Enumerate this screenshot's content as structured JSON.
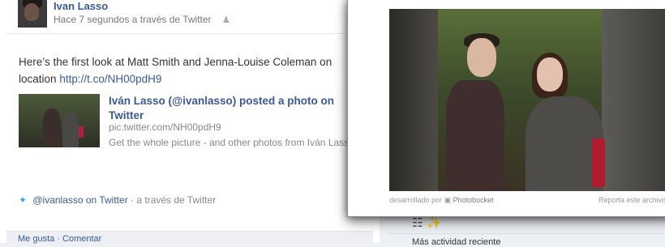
{
  "post": {
    "author": "Ivan Lasso",
    "meta": "Hace 7 segundos a través de Twitter",
    "text_before_link": "Here’s the first look at Matt Smith and Jenna-Louise Coleman on",
    "text_location": "location",
    "link": "http://t.co/NH00pdH9"
  },
  "share": {
    "title": "Iván Lasso (@ivanlasso) posted a photo on Twitter",
    "domain": "pic.twitter.com/NH00pdH9",
    "description": "Get the whole picture - and other photos from Iván Lasso"
  },
  "source": {
    "link": "@ivanlasso on Twitter",
    "via": " · a través de Twitter"
  },
  "footer": {
    "actions": "Me gusta · Comentar"
  },
  "popup": {
    "credit_prefix": "desarrollado por",
    "credit_brand": "Photobucket",
    "report": "Reporta este archivo"
  },
  "right": {
    "text": "Más actividad reciente"
  },
  "colors": {
    "link": "#3b5998",
    "twitter": "#3aa7e7"
  }
}
